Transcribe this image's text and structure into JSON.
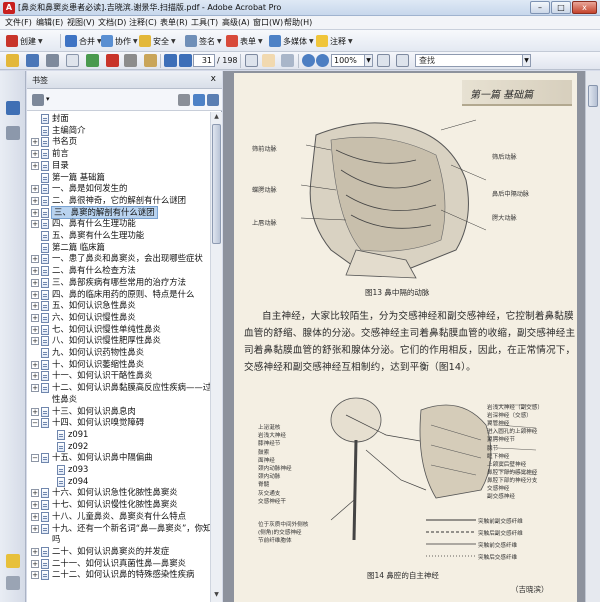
{
  "window": {
    "title": "[鼻炎和鼻窦炎患者必读].吉晓滨.谢景华.扫描版.pdf - Adobe Acrobat Pro",
    "app_icon_text": "A",
    "controls": {
      "minimize": "–",
      "maximize": "□",
      "close": "x"
    }
  },
  "menu": [
    "文件(F)",
    "编辑(E)",
    "视图(V)",
    "文档(D)",
    "注释(C)",
    "表单(R)",
    "工具(T)",
    "高级(A)",
    "窗口(W)",
    "帮助(H)"
  ],
  "toolbar1": {
    "create": "创建",
    "combine": "合并",
    "collaborate": "协作",
    "secure": "安全",
    "sign": "签名",
    "forms": "表单",
    "multimedia": "多媒体",
    "comment": "注释"
  },
  "toolbar2": {
    "current_page": "31",
    "total_pages": "/ 198",
    "zoom": "100%",
    "search_placeholder": "查找"
  },
  "bookmarks_panel": {
    "title": "书签",
    "close": "x",
    "options_label": "▾",
    "items": [
      {
        "label": "封面",
        "level": 1,
        "expander": ""
      },
      {
        "label": "主编简介",
        "level": 1,
        "expander": ""
      },
      {
        "label": "书名页",
        "level": 1,
        "expander": "+"
      },
      {
        "label": "前言",
        "level": 1,
        "expander": "+"
      },
      {
        "label": "目录",
        "level": 1,
        "expander": "+"
      },
      {
        "label": "第一篇  基础篇",
        "level": 1,
        "expander": ""
      },
      {
        "label": "一、鼻是如何发生的",
        "level": 1,
        "expander": "+"
      },
      {
        "label": "二、鼻很神奇，它的解剖有什么谜团",
        "level": 1,
        "expander": "+"
      },
      {
        "label": "三、鼻窦的解剖有什么谜团",
        "level": 1,
        "expander": "+",
        "selected": true
      },
      {
        "label": "四、鼻有什么生理功能",
        "level": 1,
        "expander": "+"
      },
      {
        "label": "五、鼻窦有什么生理功能",
        "level": 1,
        "expander": ""
      },
      {
        "label": "第二篇  临床篇",
        "level": 1,
        "expander": ""
      },
      {
        "label": "一、患了鼻炎和鼻窦炎，会出现哪些症状",
        "level": 1,
        "expander": "+"
      },
      {
        "label": "二、鼻有什么检查方法",
        "level": 1,
        "expander": "+"
      },
      {
        "label": "三、鼻部疾病有哪些常用的治疗方法",
        "level": 1,
        "expander": "+"
      },
      {
        "label": "四、鼻的临床用药的原则、特点是什么",
        "level": 1,
        "expander": "+"
      },
      {
        "label": "五、如何认识急性鼻炎",
        "level": 1,
        "expander": "+"
      },
      {
        "label": "六、如何认识慢性鼻炎",
        "level": 1,
        "expander": "+"
      },
      {
        "label": "七、如何认识慢性单纯性鼻炎",
        "level": 1,
        "expander": "+"
      },
      {
        "label": "八、如何认识慢性肥厚性鼻炎",
        "level": 1,
        "expander": "+"
      },
      {
        "label": "九、如何认识药物性鼻炎",
        "level": 1,
        "expander": ""
      },
      {
        "label": "十、如何认识萎缩性鼻炎",
        "level": 1,
        "expander": "+"
      },
      {
        "label": "十一、如何认识干酪性鼻炎",
        "level": 1,
        "expander": "+"
      },
      {
        "label": "十二、如何认识鼻黏膜高反应性疾病——过敏",
        "level": 1,
        "expander": "+"
      },
      {
        "label": "性鼻炎",
        "level": 1,
        "expander": "",
        "continuation": true
      },
      {
        "label": "十三、如何认识鼻息肉",
        "level": 1,
        "expander": "+"
      },
      {
        "label": "十四、如何认识嗅觉障碍",
        "level": 1,
        "expander": "−"
      },
      {
        "label": "z091",
        "level": 2,
        "expander": ""
      },
      {
        "label": "z092",
        "level": 2,
        "expander": ""
      },
      {
        "label": "十五、如何认识鼻中隔偏曲",
        "level": 1,
        "expander": "−"
      },
      {
        "label": "z093",
        "level": 2,
        "expander": ""
      },
      {
        "label": "z094",
        "level": 2,
        "expander": ""
      },
      {
        "label": "十六、如何认识急性化脓性鼻窦炎",
        "level": 1,
        "expander": "+"
      },
      {
        "label": "十七、如何认识慢性化脓性鼻窦炎",
        "level": 1,
        "expander": "+"
      },
      {
        "label": "十八、儿童鼻炎、鼻窦炎有什么特点",
        "level": 1,
        "expander": "+"
      },
      {
        "label": "十九、还有一个新名词“鼻—鼻窦炎”，你知道",
        "level": 1,
        "expander": "+"
      },
      {
        "label": "吗",
        "level": 1,
        "expander": "",
        "continuation": true
      },
      {
        "label": "二十、如何认识鼻窦炎的并发症",
        "level": 1,
        "expander": "+"
      },
      {
        "label": "二十一、如何认识真菌性鼻—鼻窦炎",
        "level": 1,
        "expander": "+"
      },
      {
        "label": "二十二、如何认识鼻的特殊感染性疾病",
        "level": 1,
        "expander": "+"
      }
    ]
  },
  "page": {
    "header": "第一篇  基础篇",
    "fig13": {
      "caption": "图13   鼻中隔的动脉",
      "labels_left": [
        "筛前动脉",
        "蝶腭动脉",
        "上唇动脉"
      ],
      "labels_right": [
        "筛后动脉",
        "鼻后中隔动脉",
        "腭大动脉"
      ]
    },
    "paragraph": [
      "自主神经，大家比较陌生，分为交感神经和副交感神经，它控制着鼻黏膜",
      "血管的舒缩、腺体的分泌。交感神经主司着鼻黏膜血管的收缩，副交感神经主",
      "司着鼻黏膜血管的舒张和腺体分泌。它们的作用相反，因此，在正常情况下，",
      "交感神经和副交感神经互相制约，达到平衡（图14）。"
    ],
    "fig14": {
      "caption": "图14   鼻腔的自主神经",
      "labels_left": [
        "上泌涎核",
        "岩浅大神经",
        "膝神经节",
        "鼓索",
        "面神经",
        "颈内动脉神经",
        "颈内动脉",
        "脊髓",
        "灰交通支",
        "交感神经干",
        "位于灰质中间外侧核",
        "(侧角)的交感神经",
        "节前纤维胞体"
      ],
      "labels_right": [
        "岩浅大神经（副交感）",
        "岩深神经（交感）",
        "翼管神经",
        "进入圆孔的上颌神经",
        "翼腭神经节",
        "腺节",
        "眶下神经",
        "上颌窦后壁神经",
        "鼻腔下部的感觉神经",
        "鼻腔下部的神经分支",
        "交感神经",
        "副交感神经",
        "突触前副交感纤维",
        "突触后副交感纤维",
        "突触前交感纤维",
        "突触后交感纤维"
      ]
    },
    "author": "（吉晓滨）"
  }
}
